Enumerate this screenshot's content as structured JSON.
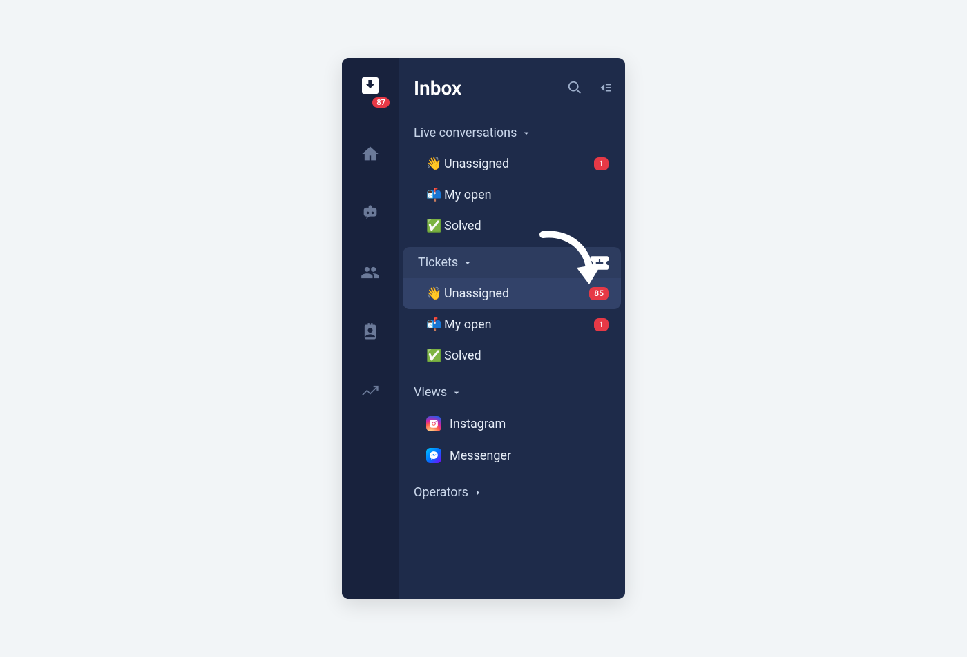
{
  "rail": {
    "badge": "87"
  },
  "header": {
    "title": "Inbox"
  },
  "sections": {
    "live": {
      "label": "Live conversations",
      "items": {
        "unassigned": {
          "emoji": "👋",
          "label": "Unassigned",
          "badge": "1"
        },
        "myopen": {
          "emoji": "📬",
          "label": "My open"
        },
        "solved": {
          "emoji": "✅",
          "label": "Solved"
        }
      }
    },
    "tickets": {
      "label": "Tickets",
      "items": {
        "unassigned": {
          "emoji": "👋",
          "label": "Unassigned",
          "badge": "85"
        },
        "myopen": {
          "emoji": "📬",
          "label": "My open",
          "badge": "1"
        },
        "solved": {
          "emoji": "✅",
          "label": "Solved"
        }
      }
    },
    "views": {
      "label": "Views",
      "items": {
        "instagram": {
          "label": "Instagram"
        },
        "messenger": {
          "label": "Messenger"
        }
      }
    },
    "operators": {
      "label": "Operators"
    }
  }
}
